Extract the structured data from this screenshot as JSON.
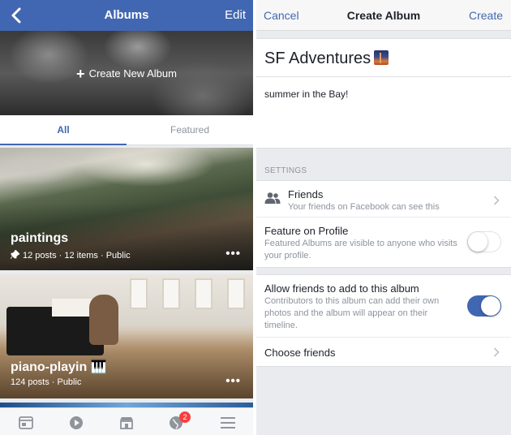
{
  "left": {
    "header": {
      "title": "Albums",
      "edit_label": "Edit",
      "back_icon": "chevron-left-icon"
    },
    "create_banner": {
      "label": "Create New Album",
      "icon": "plus-icon"
    },
    "tabs": [
      {
        "label": "All",
        "selected": true
      },
      {
        "label": "Featured",
        "selected": false
      }
    ],
    "albums": [
      {
        "title": "paintings",
        "meta": "12 posts · 12 items · Public",
        "pinned": true
      },
      {
        "title": "piano-playin 🎹",
        "meta": "124 posts · Public",
        "pinned": false
      }
    ],
    "tabbar": {
      "items": [
        "news-feed-icon",
        "video-icon",
        "marketplace-icon",
        "notifications-globe-icon",
        "menu-icon"
      ],
      "notifications_badge": "2"
    }
  },
  "right": {
    "header": {
      "cancel_label": "Cancel",
      "title": "Create Album",
      "create_label": "Create"
    },
    "album_name": "SF Adventures",
    "description": "summer in the Bay!",
    "settings_label": "SETTINGS",
    "friends": {
      "title": "Friends",
      "subtitle": "Your friends on Facebook can see this"
    },
    "feature": {
      "title": "Feature on Profile",
      "subtitle": "Featured Albums are visible to anyone who visits your profile.",
      "enabled": false
    },
    "allow": {
      "title": "Allow friends to add to this album",
      "subtitle": "Contributors to this album can add their own photos and the album will appear on their timeline.",
      "enabled": true
    },
    "choose_friends_label": "Choose friends"
  },
  "colors": {
    "brand": "#4267b2",
    "badge": "#fa3e3e",
    "muted_text": "#8d949e"
  }
}
